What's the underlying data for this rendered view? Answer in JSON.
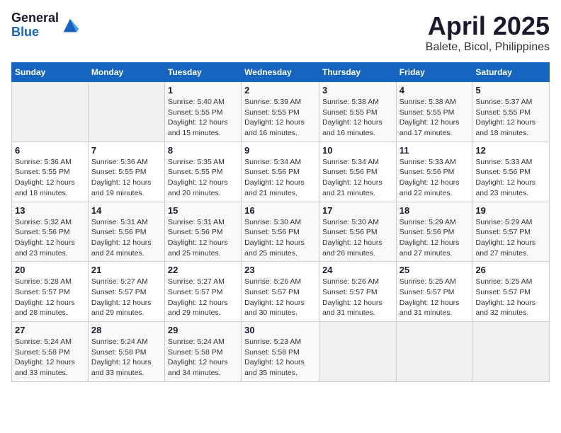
{
  "header": {
    "logo_general": "General",
    "logo_blue": "Blue",
    "title": "April 2025",
    "subtitle": "Balete, Bicol, Philippines"
  },
  "calendar": {
    "weekdays": [
      "Sunday",
      "Monday",
      "Tuesday",
      "Wednesday",
      "Thursday",
      "Friday",
      "Saturday"
    ],
    "weeks": [
      [
        {
          "day": "",
          "info": ""
        },
        {
          "day": "",
          "info": ""
        },
        {
          "day": "1",
          "info": "Sunrise: 5:40 AM\nSunset: 5:55 PM\nDaylight: 12 hours and 15 minutes."
        },
        {
          "day": "2",
          "info": "Sunrise: 5:39 AM\nSunset: 5:55 PM\nDaylight: 12 hours and 16 minutes."
        },
        {
          "day": "3",
          "info": "Sunrise: 5:38 AM\nSunset: 5:55 PM\nDaylight: 12 hours and 16 minutes."
        },
        {
          "day": "4",
          "info": "Sunrise: 5:38 AM\nSunset: 5:55 PM\nDaylight: 12 hours and 17 minutes."
        },
        {
          "day": "5",
          "info": "Sunrise: 5:37 AM\nSunset: 5:55 PM\nDaylight: 12 hours and 18 minutes."
        }
      ],
      [
        {
          "day": "6",
          "info": "Sunrise: 5:36 AM\nSunset: 5:55 PM\nDaylight: 12 hours and 18 minutes."
        },
        {
          "day": "7",
          "info": "Sunrise: 5:36 AM\nSunset: 5:55 PM\nDaylight: 12 hours and 19 minutes."
        },
        {
          "day": "8",
          "info": "Sunrise: 5:35 AM\nSunset: 5:55 PM\nDaylight: 12 hours and 20 minutes."
        },
        {
          "day": "9",
          "info": "Sunrise: 5:34 AM\nSunset: 5:56 PM\nDaylight: 12 hours and 21 minutes."
        },
        {
          "day": "10",
          "info": "Sunrise: 5:34 AM\nSunset: 5:56 PM\nDaylight: 12 hours and 21 minutes."
        },
        {
          "day": "11",
          "info": "Sunrise: 5:33 AM\nSunset: 5:56 PM\nDaylight: 12 hours and 22 minutes."
        },
        {
          "day": "12",
          "info": "Sunrise: 5:33 AM\nSunset: 5:56 PM\nDaylight: 12 hours and 23 minutes."
        }
      ],
      [
        {
          "day": "13",
          "info": "Sunrise: 5:32 AM\nSunset: 5:56 PM\nDaylight: 12 hours and 23 minutes."
        },
        {
          "day": "14",
          "info": "Sunrise: 5:31 AM\nSunset: 5:56 PM\nDaylight: 12 hours and 24 minutes."
        },
        {
          "day": "15",
          "info": "Sunrise: 5:31 AM\nSunset: 5:56 PM\nDaylight: 12 hours and 25 minutes."
        },
        {
          "day": "16",
          "info": "Sunrise: 5:30 AM\nSunset: 5:56 PM\nDaylight: 12 hours and 25 minutes."
        },
        {
          "day": "17",
          "info": "Sunrise: 5:30 AM\nSunset: 5:56 PM\nDaylight: 12 hours and 26 minutes."
        },
        {
          "day": "18",
          "info": "Sunrise: 5:29 AM\nSunset: 5:56 PM\nDaylight: 12 hours and 27 minutes."
        },
        {
          "day": "19",
          "info": "Sunrise: 5:29 AM\nSunset: 5:57 PM\nDaylight: 12 hours and 27 minutes."
        }
      ],
      [
        {
          "day": "20",
          "info": "Sunrise: 5:28 AM\nSunset: 5:57 PM\nDaylight: 12 hours and 28 minutes."
        },
        {
          "day": "21",
          "info": "Sunrise: 5:27 AM\nSunset: 5:57 PM\nDaylight: 12 hours and 29 minutes."
        },
        {
          "day": "22",
          "info": "Sunrise: 5:27 AM\nSunset: 5:57 PM\nDaylight: 12 hours and 29 minutes."
        },
        {
          "day": "23",
          "info": "Sunrise: 5:26 AM\nSunset: 5:57 PM\nDaylight: 12 hours and 30 minutes."
        },
        {
          "day": "24",
          "info": "Sunrise: 5:26 AM\nSunset: 5:57 PM\nDaylight: 12 hours and 31 minutes."
        },
        {
          "day": "25",
          "info": "Sunrise: 5:25 AM\nSunset: 5:57 PM\nDaylight: 12 hours and 31 minutes."
        },
        {
          "day": "26",
          "info": "Sunrise: 5:25 AM\nSunset: 5:57 PM\nDaylight: 12 hours and 32 minutes."
        }
      ],
      [
        {
          "day": "27",
          "info": "Sunrise: 5:24 AM\nSunset: 5:58 PM\nDaylight: 12 hours and 33 minutes."
        },
        {
          "day": "28",
          "info": "Sunrise: 5:24 AM\nSunset: 5:58 PM\nDaylight: 12 hours and 33 minutes."
        },
        {
          "day": "29",
          "info": "Sunrise: 5:24 AM\nSunset: 5:58 PM\nDaylight: 12 hours and 34 minutes."
        },
        {
          "day": "30",
          "info": "Sunrise: 5:23 AM\nSunset: 5:58 PM\nDaylight: 12 hours and 35 minutes."
        },
        {
          "day": "",
          "info": ""
        },
        {
          "day": "",
          "info": ""
        },
        {
          "day": "",
          "info": ""
        }
      ]
    ]
  }
}
